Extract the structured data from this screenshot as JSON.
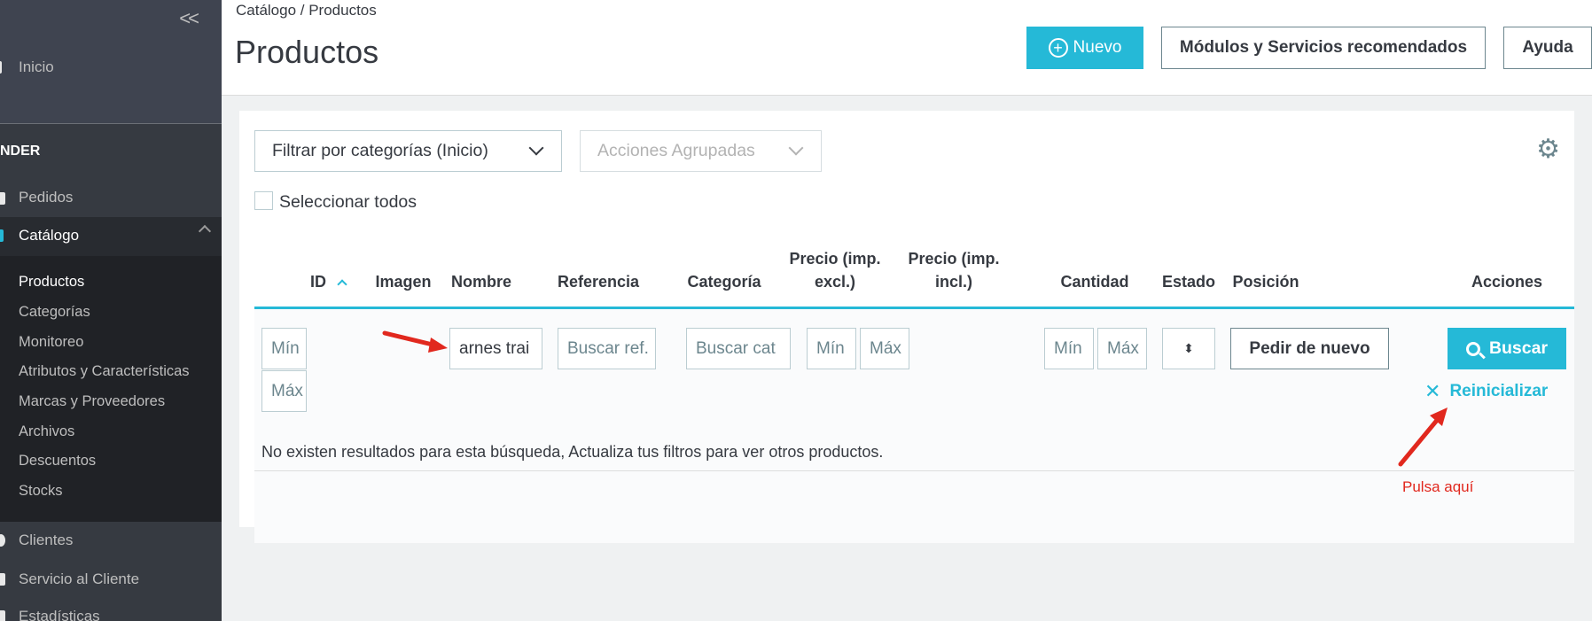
{
  "sidebar": {
    "collapse_label": "<<",
    "inicio": "Inicio",
    "section": "NDER",
    "pedidos": "Pedidos",
    "catalogo": "Catálogo",
    "catalogo_items": [
      "Productos",
      "Categorías",
      "Monitoreo",
      "Atributos y Características",
      "Marcas y Proveedores",
      "Archivos",
      "Descuentos",
      "Stocks"
    ],
    "clientes": "Clientes",
    "servicio": "Servicio al Cliente",
    "estadisticas": "Estadísticas"
  },
  "header": {
    "breadcrumb": "Catálogo / Productos",
    "title": "Productos",
    "nuevo_icon": "plus-circle-icon",
    "nuevo_label": "Nuevo",
    "modulos_label": "Módulos y Servicios recomendados",
    "ayuda_label": "Ayuda"
  },
  "toolbar": {
    "filter_category": "Filtrar por categorías (Inicio)",
    "bulk_actions": "Acciones Agrupadas",
    "select_all": "Seleccionar todos"
  },
  "table": {
    "columns": {
      "id": "ID",
      "imagen": "Imagen",
      "nombre": "Nombre",
      "referencia": "Referencia",
      "categoria": "Categoría",
      "precio_excl_1": "Precio (imp.",
      "precio_excl_2": "excl.)",
      "precio_incl_1": "Precio (imp.",
      "precio_incl_2": "incl.)",
      "cantidad": "Cantidad",
      "estado": "Estado",
      "posicion": "Posición",
      "acciones": "Acciones"
    },
    "filters": {
      "id_min": "Mín",
      "id_max": "Máx",
      "nombre_value": "arnes trai",
      "ref_placeholder": "Buscar ref.",
      "cat_placeholder": "Buscar cat",
      "price_min": "Mín",
      "price_max": "Máx",
      "qty_min": "Mín",
      "qty_max": "Máx",
      "estado_value": "⬍",
      "reorder_label": "Pedir de nuevo",
      "search_label": "Buscar",
      "reset_label": "Reinicializar"
    },
    "empty_message": "No existen resultados para esta búsqueda, Actualiza tus filtros para ver otros productos."
  },
  "annotation": {
    "text": "Pulsa aquí",
    "color": "#e1281e"
  },
  "colors": {
    "accent": "#25b9d7",
    "sidebar_bg": "#363a41"
  }
}
